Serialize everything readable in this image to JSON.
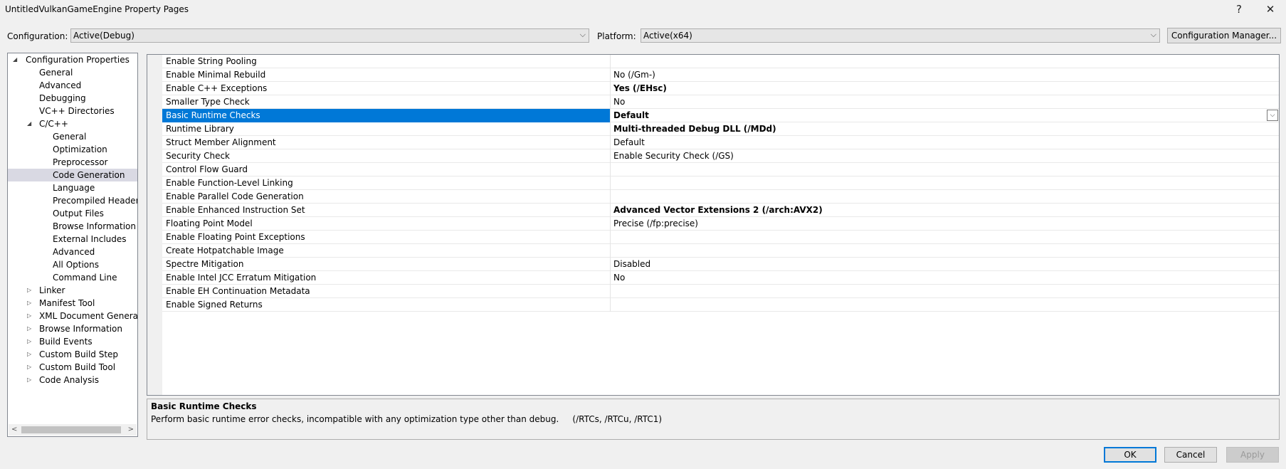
{
  "window": {
    "title": "UntitledVulkanGameEngine Property Pages",
    "help_glyph": "?",
    "close_glyph": "✕"
  },
  "config": {
    "configuration_label": "Configuration:",
    "configuration_value": "Active(Debug)",
    "platform_label": "Platform:",
    "platform_value": "Active(x64)",
    "manager_button": "Configuration Manager..."
  },
  "tree": {
    "items": [
      {
        "label": "Configuration Properties",
        "expanded": true
      },
      {
        "label": "General"
      },
      {
        "label": "Advanced"
      },
      {
        "label": "Debugging"
      },
      {
        "label": "VC++ Directories"
      },
      {
        "label": "C/C++",
        "expanded": true
      },
      {
        "label": "General"
      },
      {
        "label": "Optimization"
      },
      {
        "label": "Preprocessor"
      },
      {
        "label": "Code Generation",
        "selected": true
      },
      {
        "label": "Language"
      },
      {
        "label": "Precompiled Headers"
      },
      {
        "label": "Output Files"
      },
      {
        "label": "Browse Information"
      },
      {
        "label": "External Includes"
      },
      {
        "label": "Advanced"
      },
      {
        "label": "All Options"
      },
      {
        "label": "Command Line"
      },
      {
        "label": "Linker",
        "expanded": false
      },
      {
        "label": "Manifest Tool",
        "expanded": false
      },
      {
        "label": "XML Document Generator",
        "expanded": false
      },
      {
        "label": "Browse Information",
        "expanded": false
      },
      {
        "label": "Build Events",
        "expanded": false
      },
      {
        "label": "Custom Build Step",
        "expanded": false
      },
      {
        "label": "Custom Build Tool",
        "expanded": false
      },
      {
        "label": "Code Analysis",
        "expanded": false
      }
    ]
  },
  "properties": [
    {
      "name": "Enable String Pooling",
      "value": "",
      "bold": false
    },
    {
      "name": "Enable Minimal Rebuild",
      "value": "No (/Gm-)",
      "bold": false
    },
    {
      "name": "Enable C++ Exceptions",
      "value": "Yes (/EHsc)",
      "bold": true
    },
    {
      "name": "Smaller Type Check",
      "value": "No",
      "bold": false
    },
    {
      "name": "Basic Runtime Checks",
      "value": "Default",
      "bold": true,
      "selected": true
    },
    {
      "name": "Runtime Library",
      "value": "Multi-threaded Debug DLL (/MDd)",
      "bold": true
    },
    {
      "name": "Struct Member Alignment",
      "value": "Default",
      "bold": false
    },
    {
      "name": "Security Check",
      "value": "Enable Security Check (/GS)",
      "bold": false
    },
    {
      "name": "Control Flow Guard",
      "value": "",
      "bold": false
    },
    {
      "name": "Enable Function-Level Linking",
      "value": "",
      "bold": false
    },
    {
      "name": "Enable Parallel Code Generation",
      "value": "",
      "bold": false
    },
    {
      "name": "Enable Enhanced Instruction Set",
      "value": "Advanced Vector Extensions 2 (/arch:AVX2)",
      "bold": true
    },
    {
      "name": "Floating Point Model",
      "value": "Precise (/fp:precise)",
      "bold": false
    },
    {
      "name": "Enable Floating Point Exceptions",
      "value": "",
      "bold": false
    },
    {
      "name": "Create Hotpatchable Image",
      "value": "",
      "bold": false
    },
    {
      "name": "Spectre Mitigation",
      "value": "Disabled",
      "bold": false
    },
    {
      "name": "Enable Intel JCC Erratum Mitigation",
      "value": "No",
      "bold": false
    },
    {
      "name": "Enable EH Continuation Metadata",
      "value": "",
      "bold": false
    },
    {
      "name": "Enable Signed Returns",
      "value": "",
      "bold": false
    }
  ],
  "description": {
    "title": "Basic Runtime Checks",
    "text": "Perform basic runtime error checks, incompatible with any optimization type other than debug.     (/RTCs, /RTCu, /RTC1)"
  },
  "buttons": {
    "ok": "OK",
    "cancel": "Cancel",
    "apply": "Apply"
  }
}
